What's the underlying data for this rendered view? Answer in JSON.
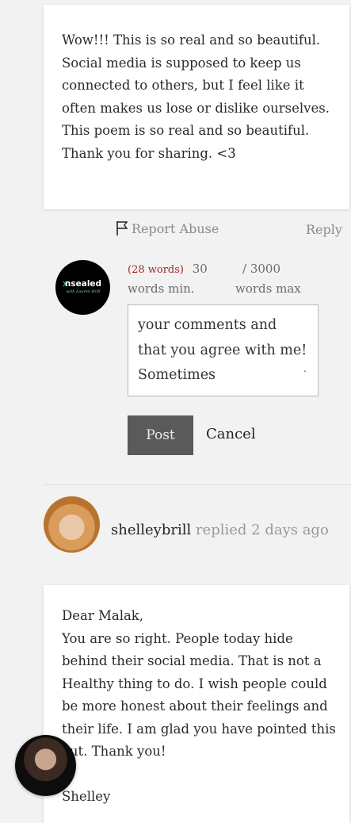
{
  "comment1": {
    "text": "Wow!!! This is so real and so beautiful. Social media is supposed to keep us connected to others, but I feel like it often makes us lose or dislike ourselves. This poem is so real and so beautiful. Thank you for sharing. <3"
  },
  "actions": {
    "report_label": "Report Abuse",
    "reply_label": "Reply"
  },
  "site_avatar": {
    "logo_text": "nsealed",
    "logo_sub": "with Lauren Brill"
  },
  "editor": {
    "word_count": "(28 words)",
    "min_value": "30",
    "min_label": "words min.",
    "max_value": "/ 3000",
    "max_label": "words max",
    "text": "your comments and that you agree with me! Sometimes",
    "overflow_mark": ".",
    "post_label": "Post",
    "cancel_label": "Cancel"
  },
  "reply": {
    "username": "shelleybrill",
    "action_text": "replied 2 days ago"
  },
  "comment2": {
    "text": "Dear Malak,\nYou are so right. People today hide behind their social media. That is not a Healthy thing to do. I wish people could be more honest about their feelings and their life. I am glad you have pointed this out. Thank you!\n\nShelley"
  }
}
